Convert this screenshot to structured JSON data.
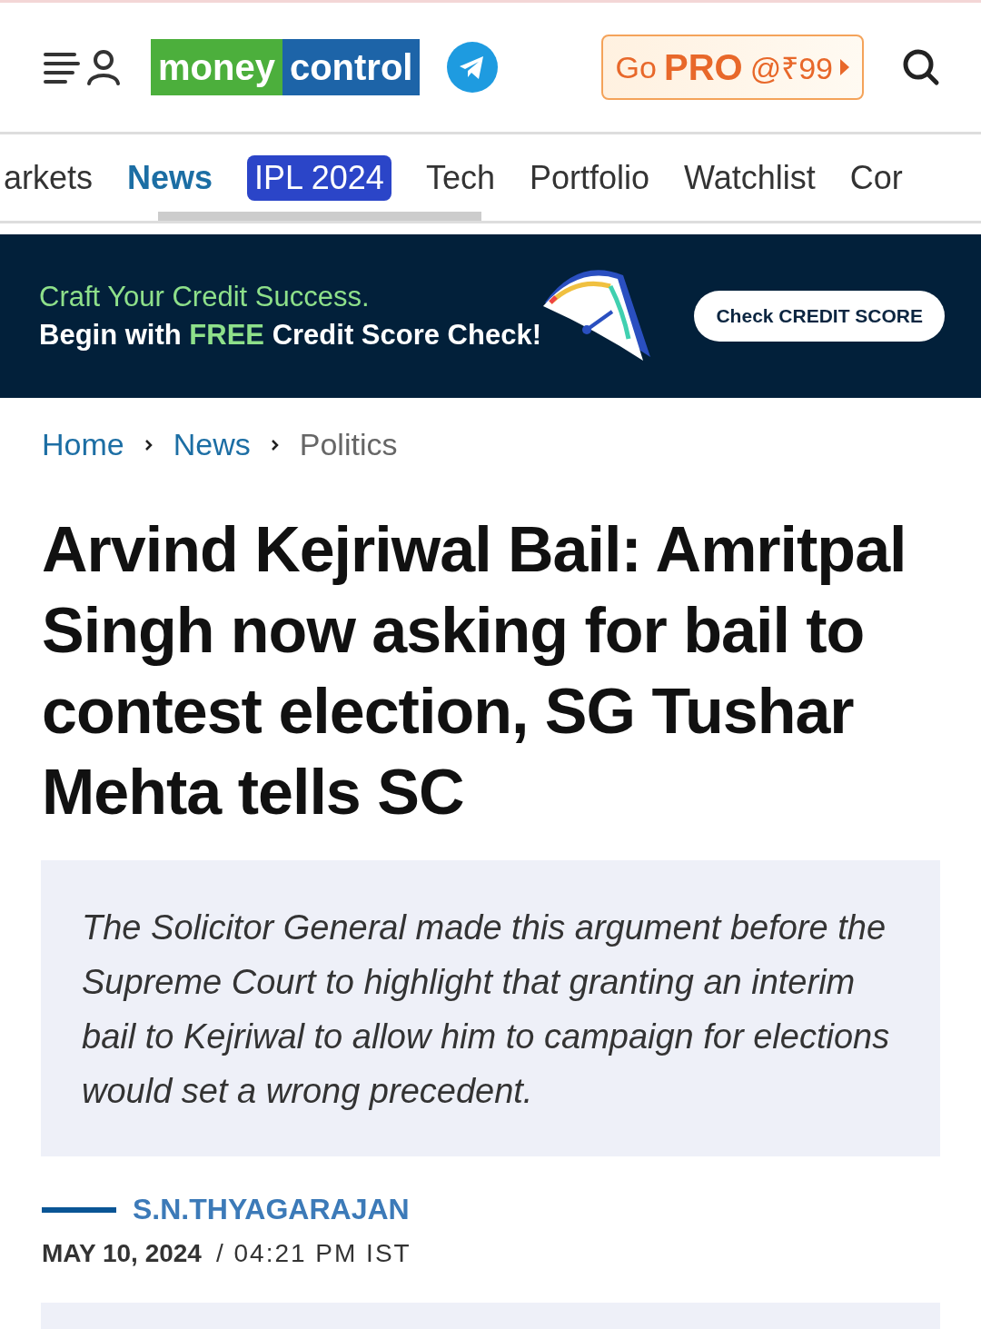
{
  "header": {
    "logo": {
      "part_1": "money",
      "part_2": "control"
    },
    "pro_button": {
      "prefix": "Go",
      "brand": "PRO",
      "price": "@₹99"
    }
  },
  "nav_tabs": [
    {
      "label": "arkets",
      "selected": false,
      "kind": "plain"
    },
    {
      "label": "News",
      "selected": true,
      "kind": "plain"
    },
    {
      "label": "IPL 2024",
      "selected": false,
      "kind": "badge"
    },
    {
      "label": "Tech",
      "selected": false,
      "kind": "plain"
    },
    {
      "label": "Portfolio",
      "selected": false,
      "kind": "plain"
    },
    {
      "label": "Watchlist",
      "selected": false,
      "kind": "plain"
    },
    {
      "label": "Cor",
      "selected": false,
      "kind": "plain"
    }
  ],
  "banner": {
    "line_1": "Craft Your Credit Success.",
    "line_2_before": "Begin with",
    "line_2_highlight": "FREE",
    "line_2_after": "Credit Score Check!",
    "button": "Check CREDIT SCORE"
  },
  "breadcrumbs": [
    {
      "label": "Home",
      "kind": "link"
    },
    {
      "label": "News",
      "kind": "link"
    },
    {
      "label": "Politics",
      "kind": "current"
    }
  ],
  "article": {
    "title": "Arvind Kejriwal Bail: Amritpal Singh now asking for bail to contest election, SG Tushar Mehta tells SC",
    "summary": "The Solicitor General made this argument before the Supreme Court to highlight that granting an interim bail to Kejriwal to allow him to campaign for elections would set a wrong precedent.",
    "author": "S.N.THYAGARAJAN",
    "date": "MAY 10, 2024",
    "time": "/ 04:21 PM IST"
  }
}
